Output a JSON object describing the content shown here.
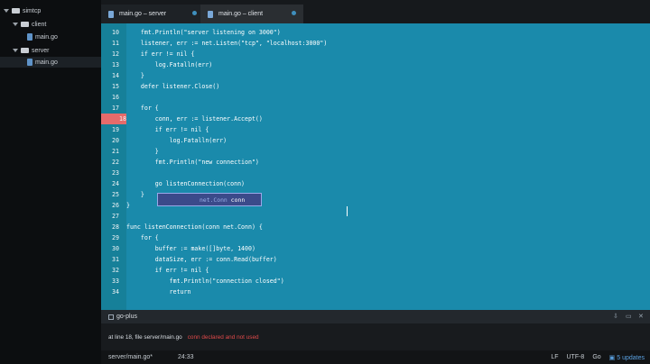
{
  "sidebar": {
    "root": "simtcp",
    "folders": [
      {
        "name": "client",
        "files": [
          "main.go"
        ]
      },
      {
        "name": "server",
        "files": [
          "main.go"
        ]
      }
    ]
  },
  "tabs": [
    {
      "label": "main.go – server",
      "active": true
    },
    {
      "label": "main.go – client",
      "active": false
    }
  ],
  "editor": {
    "lines": [
      {
        "num": "10",
        "text": "    fmt.Println(\"server listening on 3000\")"
      },
      {
        "num": "11",
        "text": "    listener, err := net.Listen(\"tcp\", \"localhost:3000\")"
      },
      {
        "num": "12",
        "text": "    if err != nil {"
      },
      {
        "num": "13",
        "text": "        log.Fatalln(err)"
      },
      {
        "num": "14",
        "text": "    }"
      },
      {
        "num": "15",
        "text": "    defer listener.Close()"
      },
      {
        "num": "16",
        "text": ""
      },
      {
        "num": "17",
        "text": "    for {"
      },
      {
        "num": "18",
        "text": "        conn, err := listener.Accept()"
      },
      {
        "num": "19",
        "text": "        if err != nil {"
      },
      {
        "num": "20",
        "text": "            log.Fatalln(err)"
      },
      {
        "num": "21",
        "text": "        }"
      },
      {
        "num": "22",
        "text": "        fmt.Println(\"new connection\")"
      },
      {
        "num": "23",
        "text": ""
      },
      {
        "num": "24",
        "text": "        go listenConnection(conn)"
      },
      {
        "num": "25",
        "text": "    }"
      },
      {
        "num": "26",
        "text": "}"
      },
      {
        "num": "27",
        "text": ""
      },
      {
        "num": "28",
        "text": "func listenConnection(conn net.Conn) {"
      },
      {
        "num": "29",
        "text": "    for {"
      },
      {
        "num": "30",
        "text": "        buffer := make([]byte, 1400)"
      },
      {
        "num": "31",
        "text": "        dataSize, err := conn.Read(buffer)"
      },
      {
        "num": "32",
        "text": "        if err != nil {"
      },
      {
        "num": "33",
        "text": "            fmt.Println(\"connection closed\")"
      },
      {
        "num": "34",
        "text": "            return"
      }
    ],
    "highlighted_line": "18",
    "autocomplete": {
      "type": "net.Conn",
      "name": "conn"
    }
  },
  "panel": {
    "title": "go-plus",
    "location": "at line 18, file server/main.go",
    "error": "conn declared and not used"
  },
  "status": {
    "file": "server/main.go*",
    "position": "24:33",
    "line_ending": "LF",
    "encoding": "UTF-8",
    "grammar": "Go",
    "updates": "5 updates"
  },
  "colors": {
    "editor_bg": "#1a8aab",
    "highlight": "#e66b6b",
    "error": "#e04a4a",
    "updates": "#5aa0e0"
  }
}
